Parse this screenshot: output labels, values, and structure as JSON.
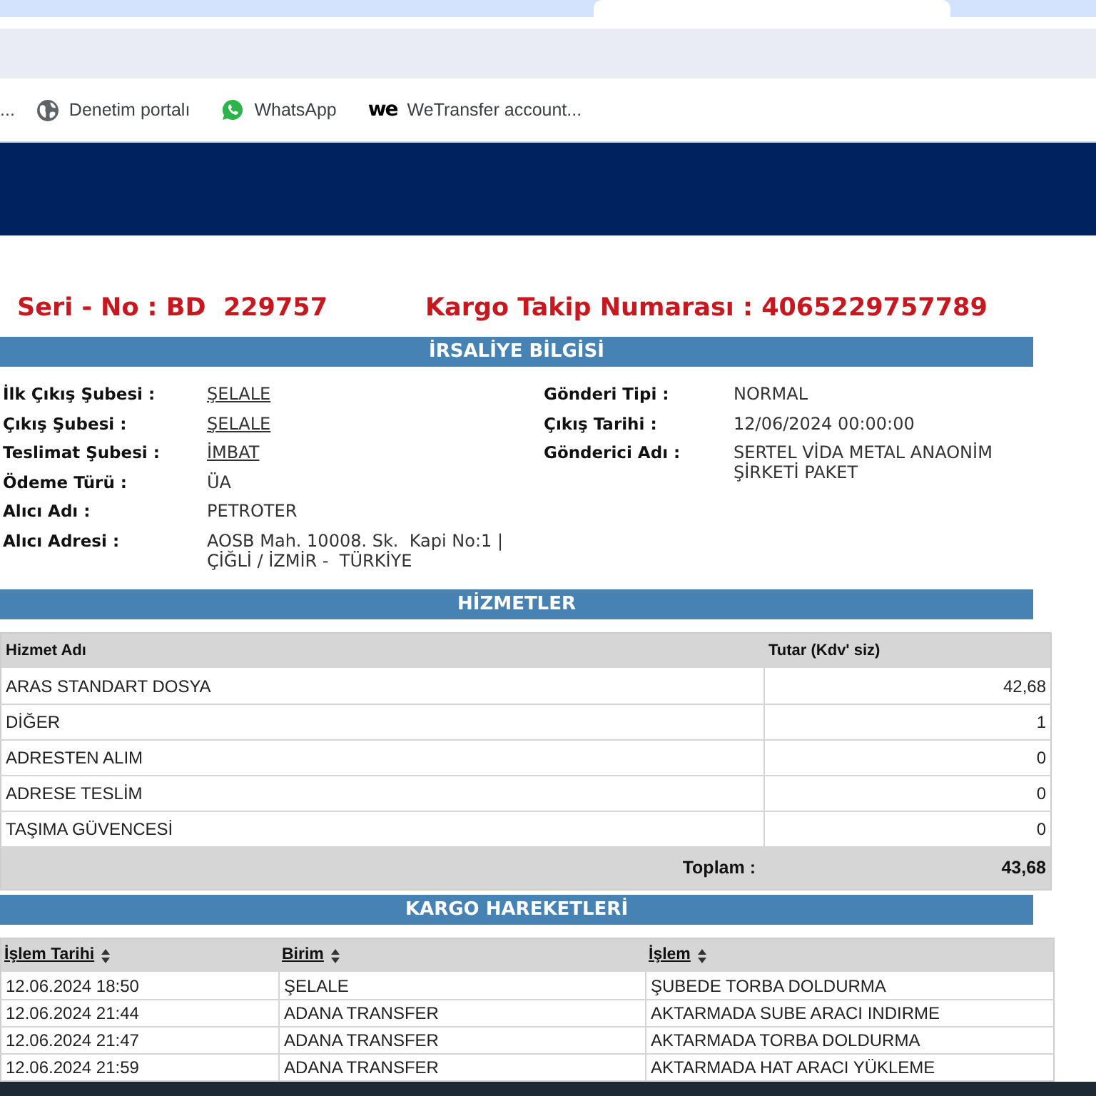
{
  "browser": {
    "bookmarks": [
      {
        "kind": "plain",
        "label": "..."
      },
      {
        "kind": "globe",
        "label": "Denetim portalı"
      },
      {
        "kind": "chat",
        "label": "WhatsApp"
      },
      {
        "kind": "wordmark",
        "mark": "we",
        "label": "WeTransfer account..."
      }
    ]
  },
  "heading": {
    "serial": "Seri - No : BD  229757",
    "tracking": "Kargo Takip Numarası : 4065229757789"
  },
  "waybill": {
    "title": "İRSALİYE BİLGİSİ",
    "left": [
      {
        "label": "İlk Çıkış Şubesi :",
        "value": "ŞELALE",
        "link": true
      },
      {
        "label": "Çıkış Şubesi :",
        "value": "ŞELALE",
        "link": true
      },
      {
        "label": "Teslimat Şubesi :",
        "value": "İMBAT",
        "link": true
      },
      {
        "label": "Ödeme Türü :",
        "value": "ÜA",
        "link": false
      },
      {
        "label": "Alıcı Adı :",
        "value": "PETROTER",
        "link": false
      },
      {
        "label": "Alıcı Adresi :",
        "value": "AOSB Mah. 10008. Sk.  Kapi No:1 | ÇİĞLİ / İZMİR -  TÜRKİYE",
        "link": false
      }
    ],
    "right": [
      {
        "label": "Gönderi Tipi :",
        "value": "NORMAL",
        "link": false
      },
      {
        "label": "Çıkış Tarihi :",
        "value": "12/06/2024 00:00:00",
        "link": false
      },
      {
        "label": "Gönderici Adı :",
        "value": "SERTEL VİDA METAL ANAONİM ŞİRKETİ PAKET",
        "link": false
      }
    ]
  },
  "services": {
    "title": "HİZMETLER",
    "columns": [
      "Hizmet Adı",
      "Tutar (Kdv' siz)"
    ],
    "rows": [
      [
        "ARAS STANDART DOSYA",
        "42,68"
      ],
      [
        "DİĞER",
        "1"
      ],
      [
        "ADRESTEN ALIM",
        "0"
      ],
      [
        "ADRESE TESLİM",
        "0"
      ],
      [
        "TAŞIMA GÜVENCESİ",
        "0"
      ]
    ],
    "total_label": "Toplam :",
    "total": "43,68"
  },
  "movements": {
    "title": "KARGO HAREKETLERİ",
    "columns": [
      "İşlem Tarihi",
      "Birim",
      "İşlem"
    ],
    "rows": [
      [
        "12.06.2024 18:50",
        "ŞELALE",
        "ŞUBEDE TORBA DOLDURMA"
      ],
      [
        "12.06.2024 21:44",
        "ADANA TRANSFER",
        "AKTARMADA SUBE ARACI INDIRME"
      ],
      [
        "12.06.2024 21:47",
        "ADANA TRANSFER",
        "AKTARMADA TORBA DOLDURMA"
      ],
      [
        "12.06.2024 21:59",
        "ADANA TRANSFER",
        "AKTARMADA HAT ARACI YÜKLEME"
      ]
    ]
  }
}
